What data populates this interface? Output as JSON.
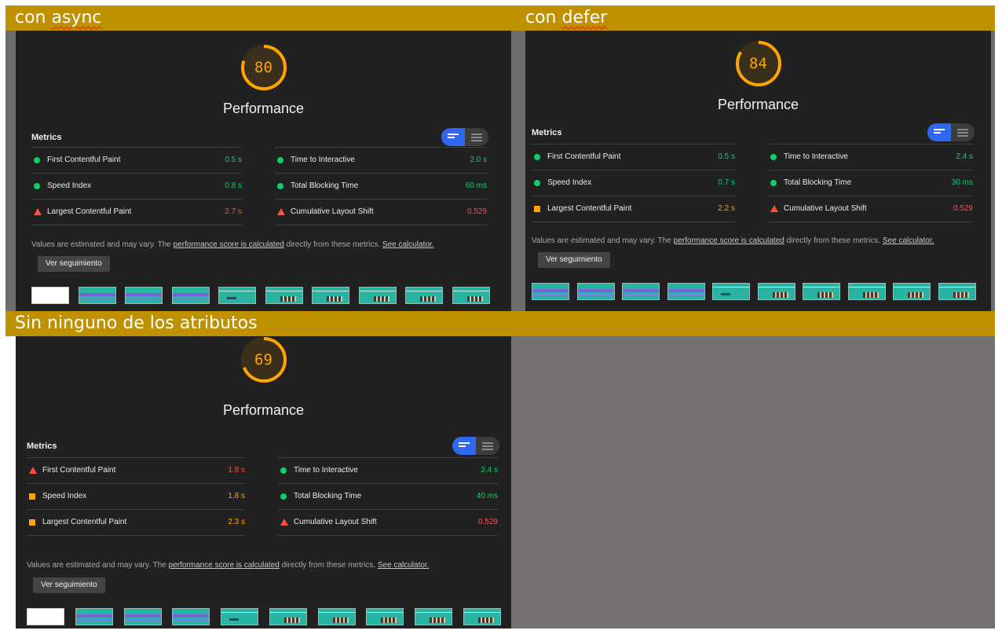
{
  "sections": [
    {
      "heading_parts": [
        "con ",
        "async"
      ],
      "score": 80,
      "score_fraction": 0.8,
      "title": "Performance",
      "metrics_label": "Metrics",
      "left_metrics": [
        {
          "name": "First Contentful Paint",
          "value": "0.5 s",
          "status": "good"
        },
        {
          "name": "Speed Index",
          "value": "0.8 s",
          "status": "good"
        },
        {
          "name": "Largest Contentful Paint",
          "value": "2.7 s",
          "status": "fail"
        }
      ],
      "right_metrics": [
        {
          "name": "Time to Interactive",
          "value": "2.0 s",
          "status": "good"
        },
        {
          "name": "Total Blocking Time",
          "value": "60 ms",
          "status": "good"
        },
        {
          "name": "Cumulative Layout Shift",
          "value": "0.529",
          "status": "fail"
        }
      ],
      "note": {
        "prefix": "Values are estimated and may vary. The ",
        "link1": "performance score is calculated",
        "middle": " directly from these metrics. ",
        "link2": "See calculator."
      },
      "button_label": "Ver seguimiento",
      "thumbnails": [
        "blank",
        "purple",
        "purple",
        "purple",
        "teal",
        "photo",
        "photo",
        "photo",
        "photo",
        "photo"
      ]
    },
    {
      "heading_parts": [
        "con ",
        "defer"
      ],
      "score": 84,
      "score_fraction": 0.84,
      "title": "Performance",
      "metrics_label": "Metrics",
      "left_metrics": [
        {
          "name": "First Contentful Paint",
          "value": "0.5 s",
          "status": "good"
        },
        {
          "name": "Speed Index",
          "value": "0.7 s",
          "status": "good"
        },
        {
          "name": "Largest Contentful Paint",
          "value": "2.2 s",
          "status": "avg"
        }
      ],
      "right_metrics": [
        {
          "name": "Time to Interactive",
          "value": "2.4 s",
          "status": "good"
        },
        {
          "name": "Total Blocking Time",
          "value": "30 ms",
          "status": "good"
        },
        {
          "name": "Cumulative Layout Shift",
          "value": "0.529",
          "status": "fail"
        }
      ],
      "note": {
        "prefix": "Values are estimated and may vary. The ",
        "link1": "performance score is calculated",
        "middle": " directly from these metrics. ",
        "link2": "See calculator."
      },
      "button_label": "Ver seguimiento",
      "thumbnails": [
        "purple",
        "purple",
        "purple",
        "purple",
        "teal",
        "photo",
        "photo",
        "photo",
        "photo",
        "photo"
      ]
    },
    {
      "heading_parts": [
        "Sin ninguno de los atributos",
        ""
      ],
      "score": 69,
      "score_fraction": 0.69,
      "title": "Performance",
      "metrics_label": "Metrics",
      "left_metrics": [
        {
          "name": "First Contentful Paint",
          "value": "1.8 s",
          "status": "fail"
        },
        {
          "name": "Speed Index",
          "value": "1.8 s",
          "status": "avg"
        },
        {
          "name": "Largest Contentful Paint",
          "value": "2.3 s",
          "status": "avg"
        }
      ],
      "right_metrics": [
        {
          "name": "Time to Interactive",
          "value": "2.4 s",
          "status": "good"
        },
        {
          "name": "Total Blocking Time",
          "value": "40 ms",
          "status": "good"
        },
        {
          "name": "Cumulative Layout Shift",
          "value": "0.529",
          "status": "fail"
        }
      ],
      "note": {
        "prefix": "Values are estimated and may vary. The ",
        "link1": "performance score is calculated",
        "middle": " directly from these metrics. ",
        "link2": "See calculator."
      },
      "button_label": "Ver seguimiento",
      "thumbnails": [
        "blank",
        "purple",
        "purple",
        "purple",
        "teal",
        "photo",
        "photo",
        "photo",
        "photo",
        "photo"
      ]
    }
  ],
  "colors": {
    "heading_bar": "#bf9000",
    "panel": "#212121",
    "good": "#0cce6b",
    "average": "#ffa400",
    "fail": "#ff4e42",
    "toggle_active": "#2f68f0"
  },
  "icons": {
    "good": "green-circle-icon",
    "average": "orange-square-icon",
    "fail": "red-triangle-icon",
    "toggle_on": "list-compact-icon",
    "toggle_off": "list-detailed-icon"
  }
}
